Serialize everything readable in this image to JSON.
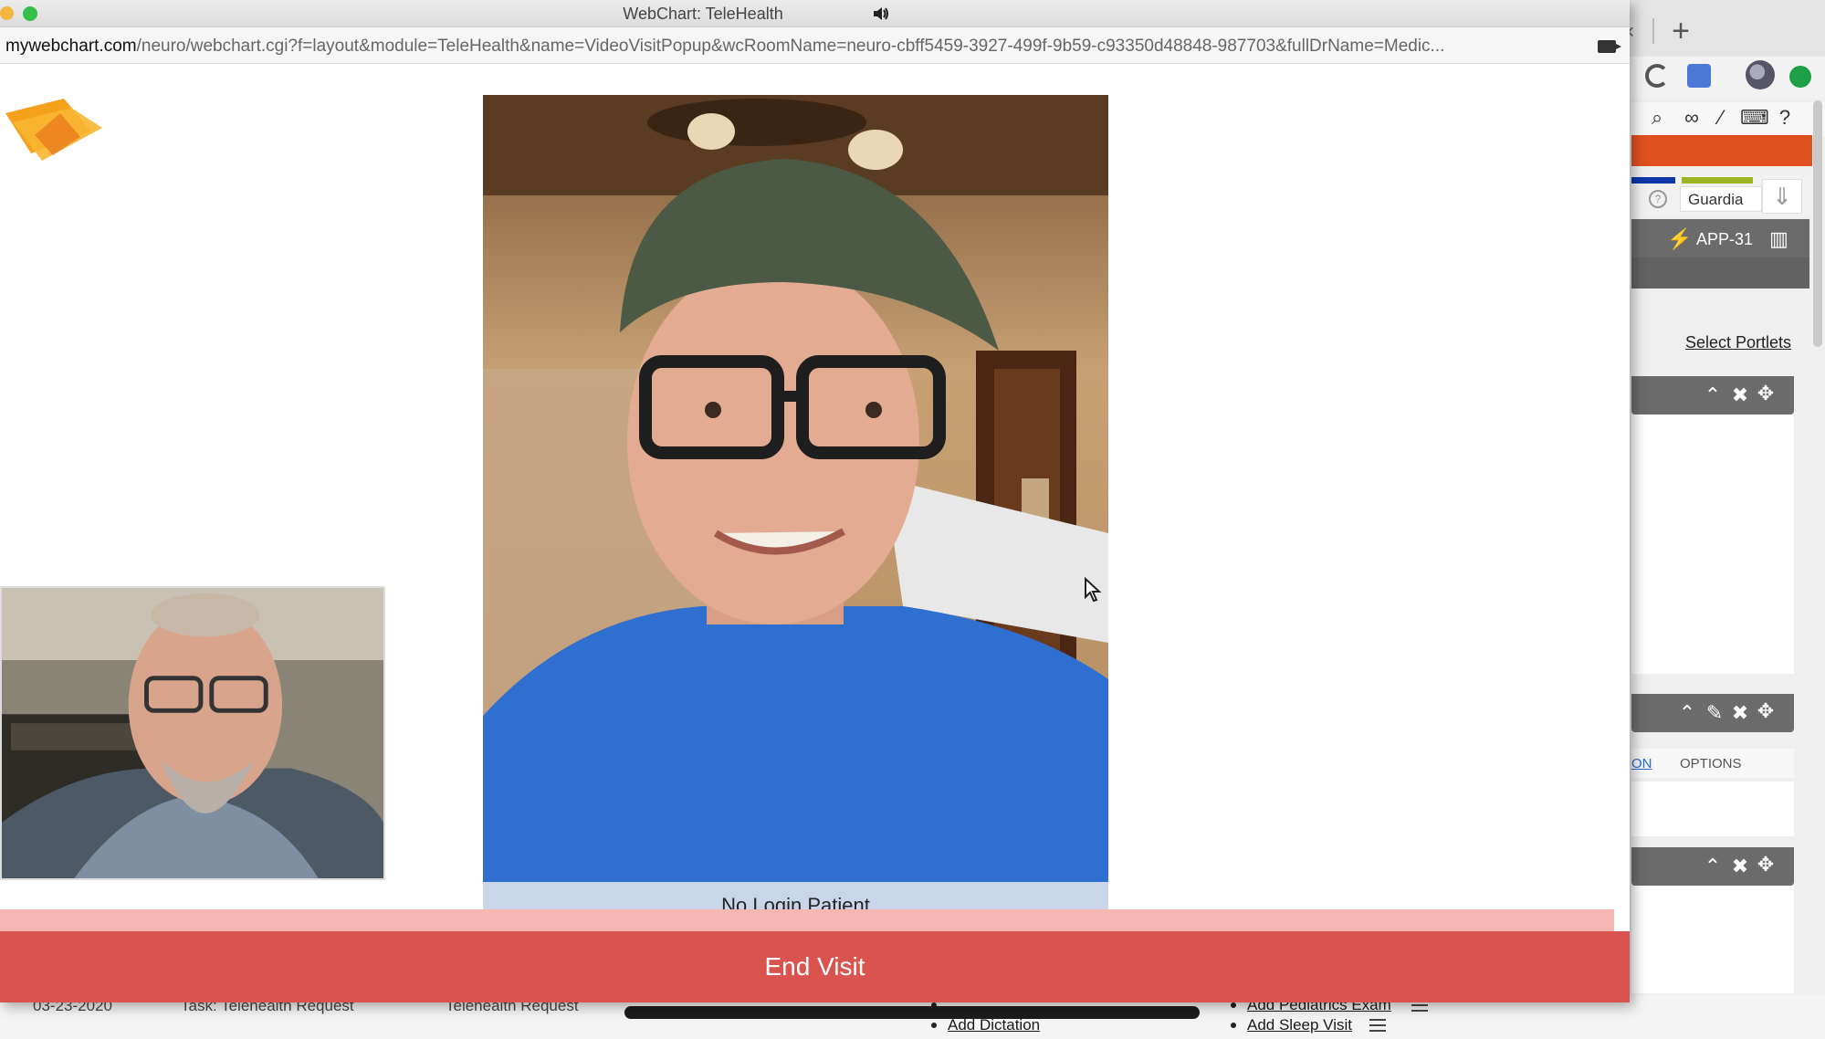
{
  "popup": {
    "title": "WebChart: TeleHealth",
    "url_host": "mywebchart.com",
    "url_path": "/neuro/webchart.cgi?f=layout&module=TeleHealth&name=VideoVisitPopup&wcRoomName=neuro-cbff5459-3927-499f-9b59-c93350d48848-987703&fullDrName=Medic...",
    "remote_caption": "No Login Patient",
    "end_visit_label": "End Visit",
    "colors": {
      "end_visit": "#d9534f",
      "caption_bg": "#c9d6ea"
    }
  },
  "background_window": {
    "guardian_label": "Guardia",
    "app_label": "APP-31",
    "select_portlets_label": "Select Portlets",
    "options_tab_on": "ON",
    "options_tab": "OPTIONS",
    "list_row": {
      "date": "03-23-2020",
      "task": "Task: Telehealth Request",
      "type": "Telehealth Request"
    },
    "links": [
      "Add Pediatrics Exam",
      "Add Dictation",
      "Add Sleep Visit"
    ],
    "icons": [
      "reload-icon",
      "translate-icon",
      "profile-avatar-icon",
      "status-icon",
      "search-icon",
      "link-icon",
      "wand-icon",
      "keyboard-icon",
      "help-icon",
      "bolt-icon",
      "chart-icon",
      "download-icon"
    ]
  }
}
